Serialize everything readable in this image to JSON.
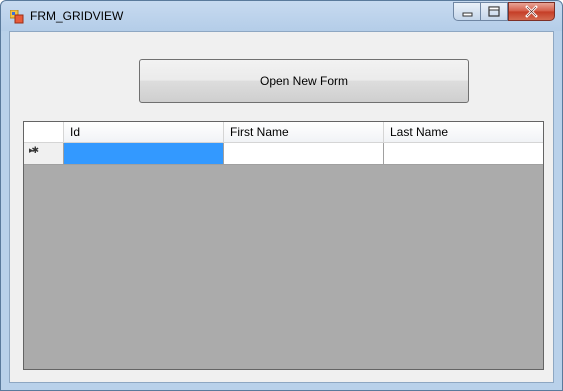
{
  "window": {
    "title": "FRM_GRIDVIEW",
    "controls": {
      "minimize_icon": "minimize-icon",
      "maximize_icon": "maximize-icon",
      "close_icon": "close-icon"
    }
  },
  "toolbar": {
    "open_new_form_label": "Open New Form"
  },
  "grid": {
    "columns": [
      "Id",
      "First Name",
      "Last Name"
    ],
    "rows": [
      {
        "row_header_glyph": "▸✱",
        "cells": [
          "",
          "",
          ""
        ],
        "selected_cell": 0,
        "is_new_row": true
      }
    ],
    "selection_color": "#3399ff",
    "background_color": "#ababab"
  }
}
